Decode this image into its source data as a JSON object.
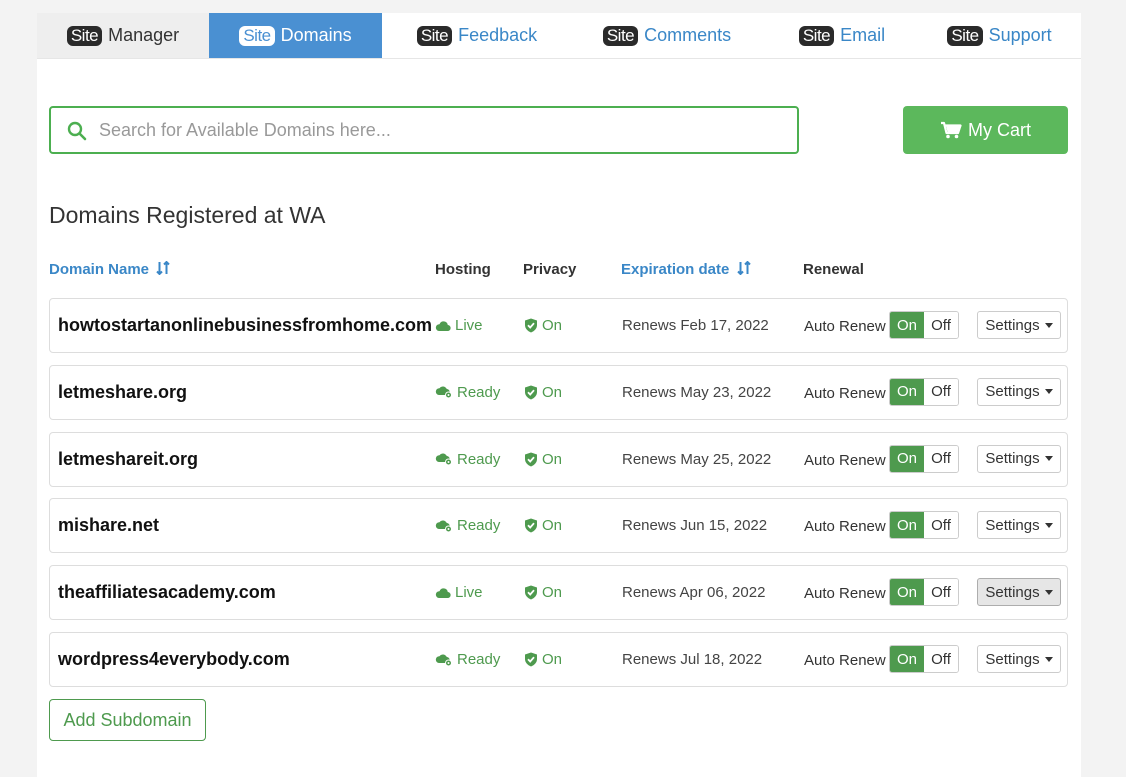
{
  "tabs": [
    {
      "badge": "Site",
      "label": "Manager"
    },
    {
      "badge": "Site",
      "label": "Domains"
    },
    {
      "badge": "Site",
      "label": "Feedback"
    },
    {
      "badge": "Site",
      "label": "Comments"
    },
    {
      "badge": "Site",
      "label": "Email"
    },
    {
      "badge": "Site",
      "label": "Support"
    }
  ],
  "search": {
    "placeholder": "Search for Available Domains here..."
  },
  "cart": {
    "label": "My Cart",
    "icon": "cart-icon"
  },
  "section_title": "Domains Registered at WA",
  "columns": {
    "domain": "Domain Name",
    "hosting": "Hosting",
    "privacy": "Privacy",
    "expiration": "Expiration date",
    "renewal": "Renewal"
  },
  "domains": [
    {
      "name": "howtostartanonlinebusinessfromhome.com",
      "hosting": "Live",
      "hosting_icon": "cloud-icon",
      "privacy": "On",
      "expires": "Renews Feb 17, 2022",
      "renew_label": "Auto Renew",
      "on": "On",
      "off": "Off",
      "settings": "Settings"
    },
    {
      "name": "letmeshare.org",
      "hosting": "Ready",
      "hosting_icon": "cloud-gear-icon",
      "privacy": "On",
      "expires": "Renews May 23, 2022",
      "renew_label": "Auto Renew",
      "on": "On",
      "off": "Off",
      "settings": "Settings"
    },
    {
      "name": "letmeshareit.org",
      "hosting": "Ready",
      "hosting_icon": "cloud-gear-icon",
      "privacy": "On",
      "expires": "Renews May 25, 2022",
      "renew_label": "Auto Renew",
      "on": "On",
      "off": "Off",
      "settings": "Settings"
    },
    {
      "name": "mishare.net",
      "hosting": "Ready",
      "hosting_icon": "cloud-gear-icon",
      "privacy": "On",
      "expires": "Renews Jun 15, 2022",
      "renew_label": "Auto Renew",
      "on": "On",
      "off": "Off",
      "settings": "Settings"
    },
    {
      "name": "theaffiliatesacademy.com",
      "hosting": "Live",
      "hosting_icon": "cloud-icon",
      "privacy": "On",
      "expires": "Renews Apr 06, 2022",
      "renew_label": "Auto Renew",
      "on": "On",
      "off": "Off",
      "settings": "Settings"
    },
    {
      "name": "wordpress4everybody.com",
      "hosting": "Ready",
      "hosting_icon": "cloud-gear-icon",
      "privacy": "On",
      "expires": "Renews Jul 18, 2022",
      "renew_label": "Auto Renew",
      "on": "On",
      "off": "Off",
      "settings": "Settings"
    }
  ],
  "add_subdomain": "Add Subdomain",
  "colors": {
    "accent_blue": "#4a90d2",
    "green": "#5cb85c",
    "text_green": "#4e9a4e",
    "link_blue": "#3a87c7"
  }
}
